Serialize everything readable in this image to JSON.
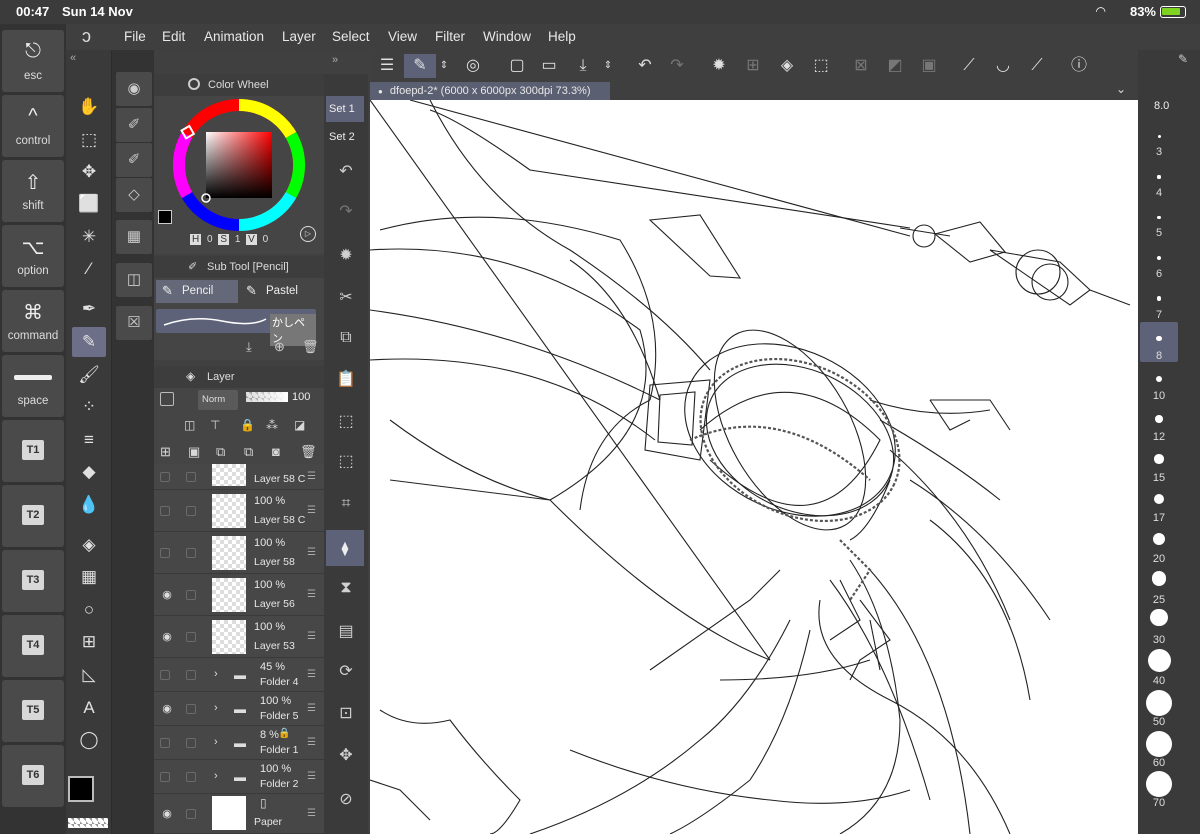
{
  "status": {
    "time": "00:47",
    "date": "Sun 14 Nov",
    "battery": "83%"
  },
  "menu": [
    "File",
    "Edit",
    "Animation",
    "Layer",
    "Select",
    "View",
    "Filter",
    "Window",
    "Help"
  ],
  "keys": [
    {
      "label": "esc",
      "glyph": "⎋"
    },
    {
      "label": "control",
      "glyph": "^"
    },
    {
      "label": "shift",
      "glyph": "⇧"
    },
    {
      "label": "option",
      "glyph": "⌥"
    },
    {
      "label": "command",
      "glyph": "⌘"
    },
    {
      "label": "space",
      "glyph": ""
    },
    {
      "label": "T1"
    },
    {
      "label": "T2"
    },
    {
      "label": "T3"
    },
    {
      "label": "T4"
    },
    {
      "label": "T5"
    },
    {
      "label": "T6"
    }
  ],
  "color_wheel": {
    "title": "Color Wheel",
    "h_label": "H",
    "h": "0",
    "s_label": "S",
    "s": "1",
    "v_label": "V",
    "v": "0",
    "main_color": "#000000",
    "sub_color": "#fff3cc"
  },
  "subtool": {
    "title": "Sub Tool [Pencil]",
    "tabs": [
      "Pencil",
      "Pastel"
    ],
    "brush_name": "かしペン"
  },
  "layer_panel": {
    "title": "Layer",
    "blend": "Norm",
    "opacity": "100",
    "layers": [
      {
        "pct": "",
        "name": "Layer 58 C",
        "visible": false,
        "type": "layer"
      },
      {
        "pct": "100 %",
        "name": "Layer 58 C",
        "visible": false,
        "type": "layer"
      },
      {
        "pct": "100 %",
        "name": "Layer 58",
        "visible": false,
        "type": "layer"
      },
      {
        "pct": "100 %",
        "name": "Layer 56",
        "visible": true,
        "type": "layer"
      },
      {
        "pct": "100 %",
        "name": "Layer 53",
        "visible": true,
        "type": "layer"
      },
      {
        "pct": "45 %",
        "name": "Folder 4",
        "visible": false,
        "type": "folder"
      },
      {
        "pct": "100 %",
        "name": "Folder 5",
        "visible": true,
        "type": "folder"
      },
      {
        "pct": "8 %",
        "name": "Folder 1",
        "visible": false,
        "type": "folder"
      },
      {
        "pct": "100 %",
        "name": "Folder 2",
        "visible": false,
        "type": "folder"
      },
      {
        "pct": "",
        "name": "Paper",
        "visible": true,
        "type": "paper"
      }
    ]
  },
  "sets": [
    "Set 1",
    "Set 2"
  ],
  "document": {
    "tab": "dfoepd-2* (6000 x 6000px 300dpi 73.3%)"
  },
  "brush_size": {
    "current": "8.0",
    "sizes": [
      "3",
      "4",
      "5",
      "6",
      "7",
      "8",
      "10",
      "12",
      "15",
      "17",
      "20",
      "25",
      "30",
      "40",
      "50",
      "60",
      "70"
    ],
    "selected": "8"
  }
}
